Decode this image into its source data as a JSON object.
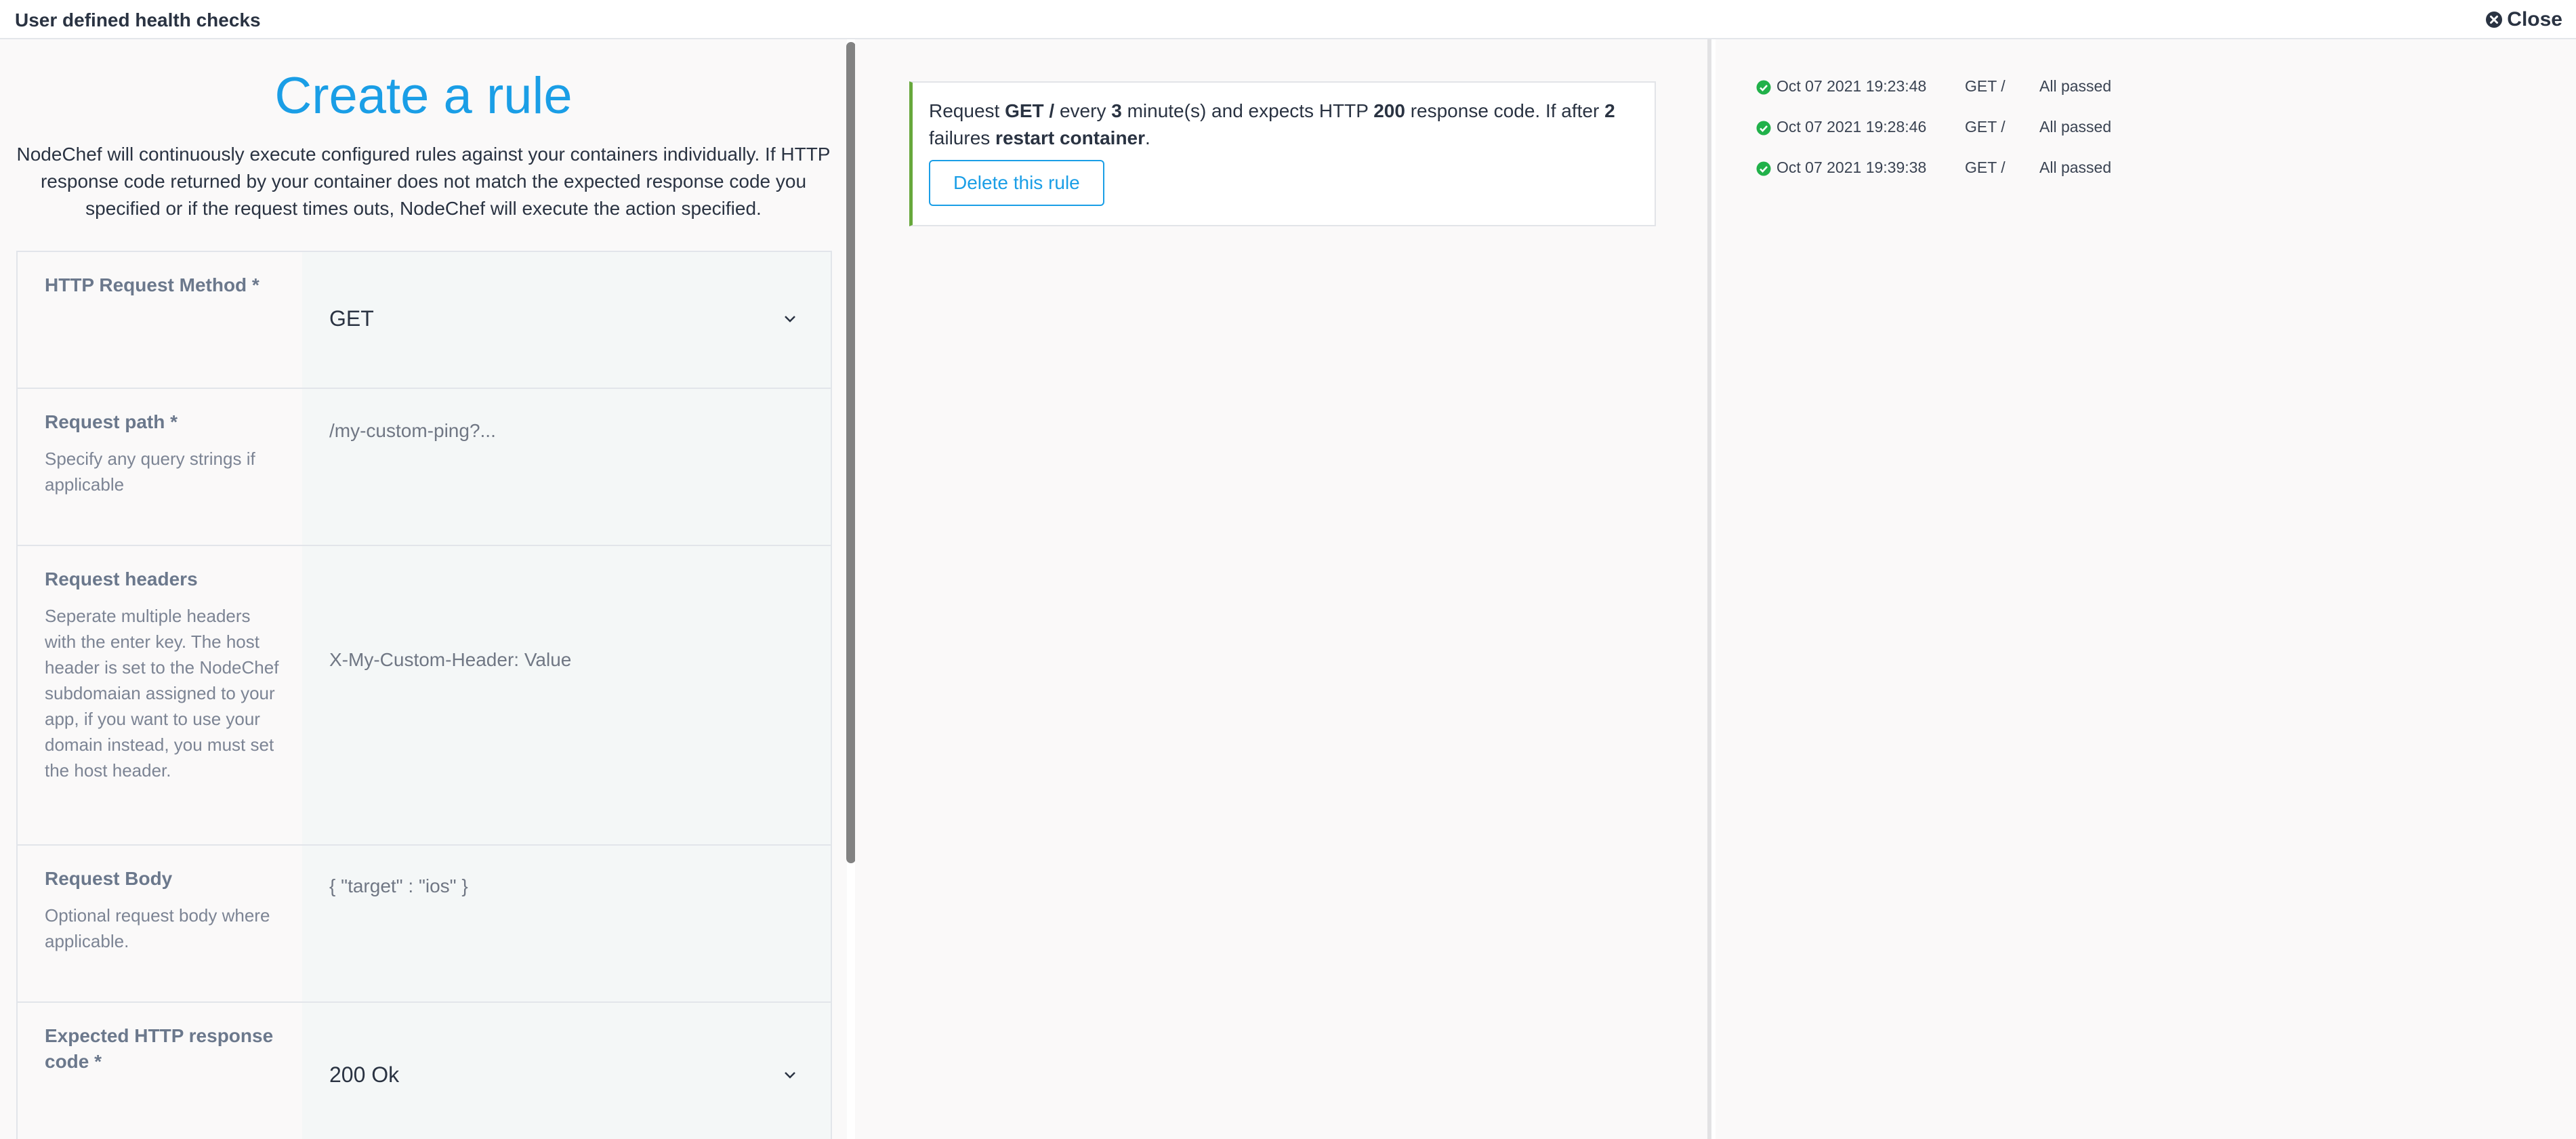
{
  "header": {
    "title": "User defined health checks",
    "close_label": "Close"
  },
  "form": {
    "title": "Create a rule",
    "intro": "NodeChef will continuously execute configured rules against your containers individually. If HTTP response code returned by your container does not match the expected response code you specified or if the request times outs, NodeChef will execute the action specified.",
    "method": {
      "label": "HTTP Request Method *",
      "value": "GET"
    },
    "path": {
      "label": "Request path *",
      "hint": "Specify any query strings if applicable",
      "placeholder": "/my-custom-ping?..."
    },
    "headers": {
      "label": "Request headers",
      "hint": "Seperate multiple headers with the enter key. The host header is set to the NodeChef subdomaian assigned to your app, if you want to use your domain instead, you must set the host header.",
      "placeholder": "X-My-Custom-Header: Value"
    },
    "body": {
      "label": "Request Body",
      "hint": "Optional request body where applicable.",
      "placeholder": "{ \"target\" : \"ios\" }"
    },
    "response": {
      "label": "Expected HTTP response code *",
      "value": "200 Ok"
    }
  },
  "rule": {
    "t1": "Request ",
    "method": "GET",
    "path": "/",
    "t2": " every ",
    "interval": "3",
    "t3": " minute(s) and expects HTTP ",
    "code": "200",
    "t4": " response code. If after ",
    "failures": "2",
    "t5": " failures ",
    "action": "restart container",
    "t6": ".",
    "delete_label": "Delete this rule"
  },
  "log": [
    {
      "date": "Oct 07 2021 19:23:48",
      "request": "GET /",
      "status": "All passed"
    },
    {
      "date": "Oct 07 2021 19:28:46",
      "request": "GET /",
      "status": "All passed"
    },
    {
      "date": "Oct 07 2021 19:39:38",
      "request": "GET /",
      "status": "All passed"
    }
  ],
  "colors": {
    "accent": "#1a9ee6",
    "success": "#21b14a",
    "rule_border": "#67a83c"
  }
}
